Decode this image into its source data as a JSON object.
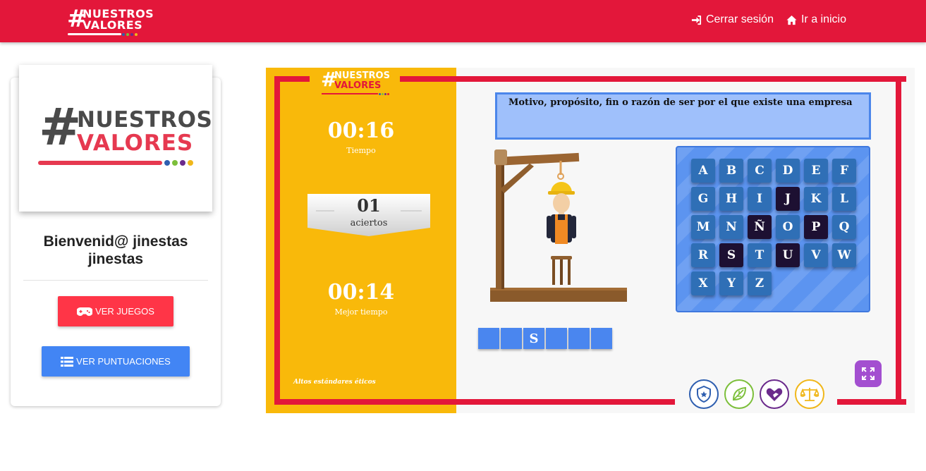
{
  "header": {
    "brand_line1": "NUESTROS",
    "brand_line2": "VALORES",
    "hash": "#",
    "logout_label": "Cerrar sesión",
    "home_label": "Ir a inicio"
  },
  "profile": {
    "logo_line1": "NUESTROS",
    "logo_line2": "VALORES",
    "welcome_line1": "Bienvenid@ jinestas",
    "welcome_line2": "jinestas",
    "games_button": "VER JUEGOS",
    "scores_button": "VER PUNTUACIONES"
  },
  "game": {
    "logo_line1": "NUESTROS",
    "logo_line2": "VALORES",
    "timer_value": "00:16",
    "timer_label": "Tiempo",
    "hits_value": "01",
    "hits_label": "aciertos",
    "best_value": "00:14",
    "best_label": "Mejor tiempo",
    "motto": "Altos estándares éticos",
    "question": "Motivo, propósito, fin o razón de ser por el que existe una empresa",
    "keys": [
      {
        "letter": "A",
        "used": false
      },
      {
        "letter": "B",
        "used": false
      },
      {
        "letter": "C",
        "used": false
      },
      {
        "letter": "D",
        "used": false
      },
      {
        "letter": "E",
        "used": false
      },
      {
        "letter": "F",
        "used": false
      },
      {
        "letter": "G",
        "used": false
      },
      {
        "letter": "H",
        "used": false
      },
      {
        "letter": "I",
        "used": false
      },
      {
        "letter": "J",
        "used": true
      },
      {
        "letter": "K",
        "used": false
      },
      {
        "letter": "L",
        "used": false
      },
      {
        "letter": "M",
        "used": false
      },
      {
        "letter": "N",
        "used": false
      },
      {
        "letter": "Ñ",
        "used": true
      },
      {
        "letter": "O",
        "used": false
      },
      {
        "letter": "P",
        "used": true
      },
      {
        "letter": "Q",
        "used": false
      },
      {
        "letter": "R",
        "used": false
      },
      {
        "letter": "S",
        "used": true
      },
      {
        "letter": "T",
        "used": false
      },
      {
        "letter": "U",
        "used": true
      },
      {
        "letter": "V",
        "used": false
      },
      {
        "letter": "W",
        "used": false
      },
      {
        "letter": "X",
        "used": false
      },
      {
        "letter": "Y",
        "used": false
      },
      {
        "letter": "Z",
        "used": false
      }
    ],
    "answer_slots": [
      "",
      "",
      "S",
      "",
      "",
      ""
    ],
    "value_icons": [
      "shield-icon",
      "leaf-icon",
      "heart-hand-icon",
      "balance-scale-icon"
    ]
  },
  "colors": {
    "primary_red": "#e3173a",
    "yellow": "#f9b90a",
    "blue": "#4285f4",
    "key_blue": "#2f6fb6",
    "key_used": "#1d1032",
    "purple": "#a34fd0",
    "green": "#7cbf3a",
    "icon_blue": "#2f5fb0",
    "icon_purple": "#6b2a8c",
    "icon_yellow": "#f0b71a"
  }
}
